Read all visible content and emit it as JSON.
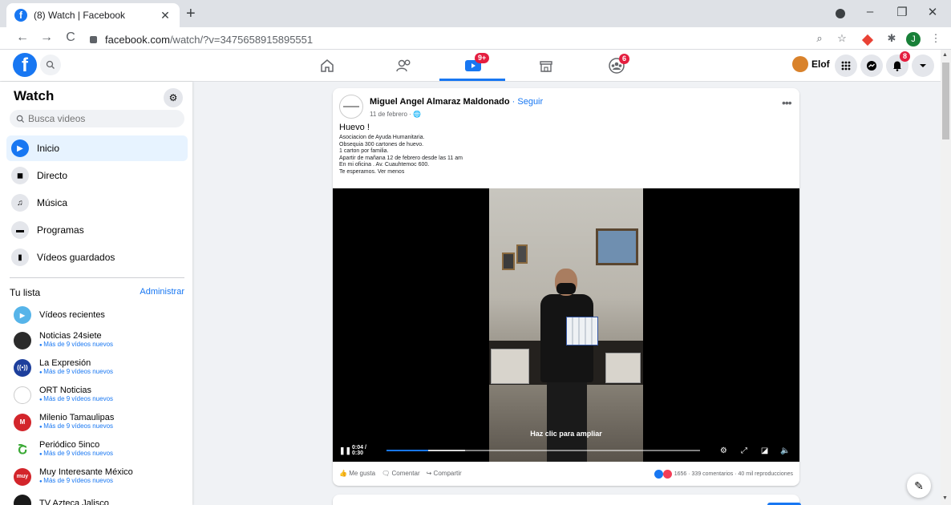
{
  "browser": {
    "tab_title": "(8) Watch | Facebook",
    "tab_close": "✕",
    "new_tab": "+",
    "url_host": "facebook.com",
    "url_path": "/watch/?v=3475658915895551",
    "nav": {
      "back": "←",
      "forward": "→",
      "reload": "C"
    },
    "window": {
      "minimize": "–",
      "restore": "❐",
      "close": "✕"
    },
    "profile_initial": "J"
  },
  "header": {
    "badges": {
      "watch": "9+",
      "groups": "6",
      "notifications": "8"
    },
    "user_name": "Elof"
  },
  "sidebar": {
    "title": "Watch",
    "search_placeholder": "Busca videos",
    "items": [
      {
        "label": "Inicio",
        "icon": "play-icon",
        "glyph": "▶"
      },
      {
        "label": "Directo",
        "icon": "live-icon",
        "glyph": "◼"
      },
      {
        "label": "Música",
        "icon": "music-icon",
        "glyph": "♫"
      },
      {
        "label": "Programas",
        "icon": "shows-icon",
        "glyph": "▬"
      },
      {
        "label": "Vídeos guardados",
        "icon": "bookmark-icon",
        "glyph": "▮"
      }
    ],
    "list_heading": "Tu lista",
    "list_admin": "Administrar",
    "recent": "Vídeos recientes",
    "pages": [
      {
        "name": "Noticias 24siete",
        "sub": "Más de 9 vídeos nuevos",
        "color": "#2b2b2b",
        "label": ""
      },
      {
        "name": "La Expresión",
        "sub": "Más de 9 vídeos nuevos",
        "color": "#1d3f9c",
        "label": "((•))"
      },
      {
        "name": "ORT Noticias",
        "sub": "Más de 9 vídeos nuevos",
        "color": "#ffffff",
        "label": ""
      },
      {
        "name": "Milenio Tamaulipas",
        "sub": "Más de 9 vídeos nuevos",
        "color": "#d3252b",
        "label": "M"
      },
      {
        "name": "Periódico 5inco",
        "sub": "Más de 9 vídeos nuevos",
        "color": "#ffffff",
        "label": "Շ"
      },
      {
        "name": "Muy Interesante México",
        "sub": "Más de 9 vídeos nuevos",
        "color": "#d3252b",
        "label": "muy"
      },
      {
        "name": "TV Azteca Jalisco",
        "sub": "",
        "color": "#1a1a1a",
        "label": ""
      }
    ]
  },
  "post": {
    "author": "Miguel Angel Almaraz Maldonado",
    "follow": " · Seguir",
    "date": "11 de febrero · 🌐",
    "title": "Huevo !",
    "body": [
      "Asociacion de Ayuda Humanitaria.",
      "Obsequia 300 cartones de huevo.",
      "1 carton por familia.",
      "Apartir de mañana 12 de febrero desde las 11 am",
      "En mi oficina . Av. Cuauhtemoc 600.",
      "Te esperamos. Ver menos"
    ],
    "video": {
      "overlay_text": "Haz clic para ampliar",
      "time": "0:04 / 0:30",
      "progress": 0.133,
      "buffered": 0.25
    },
    "actions": {
      "like": "Me gusta",
      "comment": "Comentar",
      "share": "Compartir"
    },
    "stats": "1656 · 339 comentarios · 40 mil reproducciones"
  },
  "colors": {
    "brand": "#1877f2",
    "badge": "#e41e3f"
  }
}
